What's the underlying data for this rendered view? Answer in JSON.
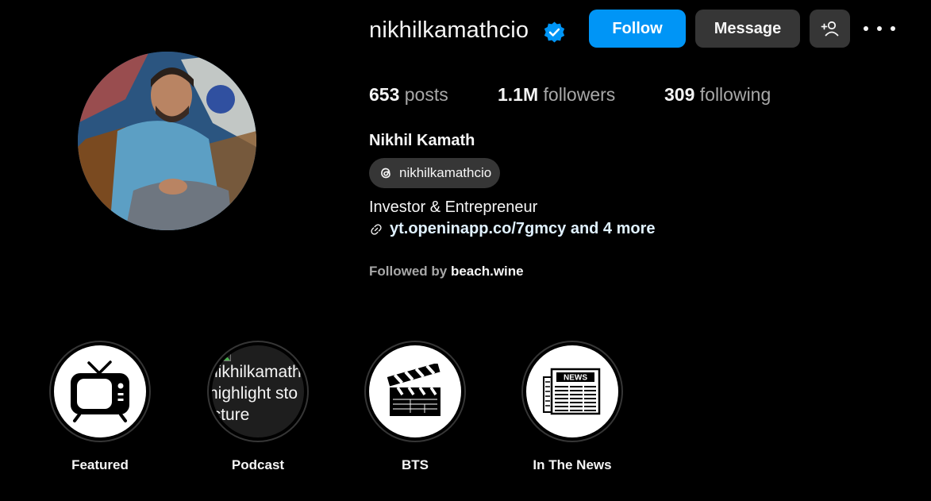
{
  "profile": {
    "username": "nikhilkamathcio",
    "full_name": "Nikhil Kamath",
    "verified": true,
    "threads_handle": "nikhilkamathcio",
    "bio": "Investor & Entrepreneur",
    "link": "yt.openinapp.co/7gmcy and 4 more",
    "followed_by_prefix": "Followed by",
    "followed_by_user": "beach.wine"
  },
  "actions": {
    "follow_label": "Follow",
    "message_label": "Message"
  },
  "stats": [
    {
      "value": "653",
      "label": "posts"
    },
    {
      "value": "1.1M",
      "label": "followers"
    },
    {
      "value": "309",
      "label": "following"
    }
  ],
  "highlights": [
    {
      "label": "Featured",
      "icon": "tv-icon"
    },
    {
      "label": "Podcast",
      "icon": "broken-image",
      "placeholder_lines": [
        "nikhilkamath",
        "highlight sto",
        "icture"
      ]
    },
    {
      "label": "BTS",
      "icon": "clapperboard-icon"
    },
    {
      "label": "In The News",
      "icon": "newspaper-icon",
      "icon_text": "NEWS"
    }
  ],
  "colors": {
    "background": "#000000",
    "follow_blue": "#0095f6",
    "secondary_button": "#363636",
    "muted_text": "#a8a8a8",
    "verified_blue": "#0095f6"
  }
}
